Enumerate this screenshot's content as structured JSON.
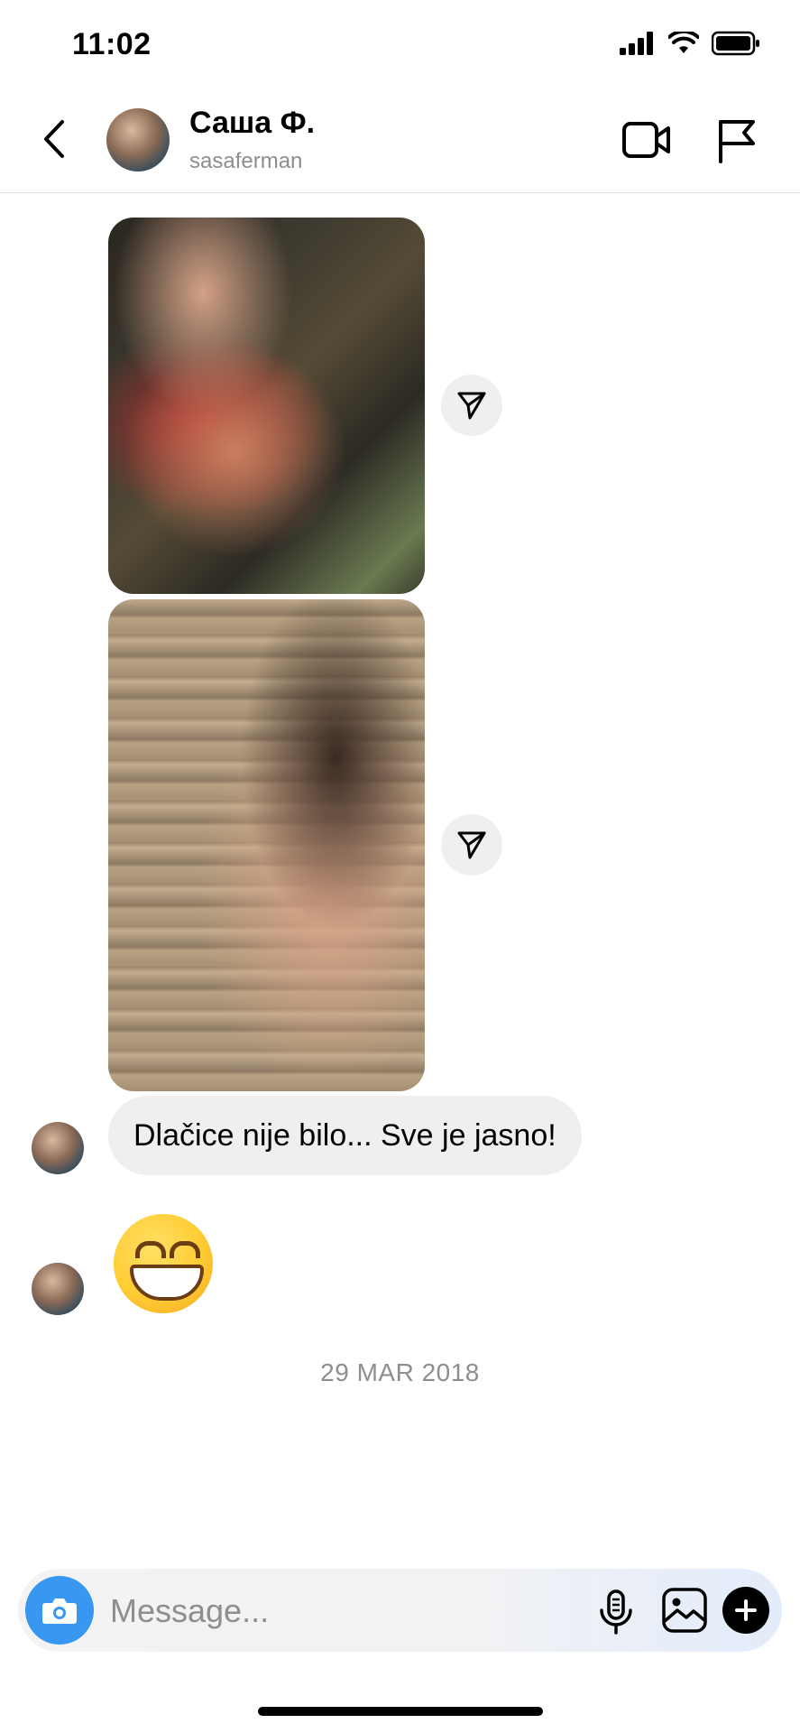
{
  "status_bar": {
    "time": "11:02"
  },
  "header": {
    "name": "Саша Ф.",
    "username": "sasaferman"
  },
  "messages": {
    "text_message": "Dlačice nije bilo... Sve je jasno!",
    "date_separator": "29 MAR 2018"
  },
  "composer": {
    "placeholder": "Message..."
  },
  "colors": {
    "accent": "#3897f0",
    "bubble": "#efefef",
    "secondary_text": "#8e8e8e"
  },
  "icons": {
    "back": "chevron-left-icon",
    "video": "video-camera-icon",
    "flag": "flag-icon",
    "share": "paper-plane-icon",
    "camera": "camera-icon",
    "mic": "microphone-icon",
    "gallery": "image-icon",
    "plus": "plus-icon"
  }
}
